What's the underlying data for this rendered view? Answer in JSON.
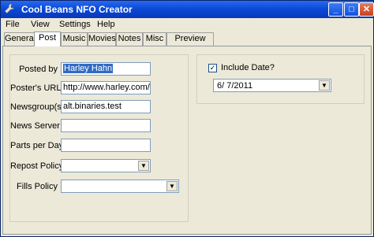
{
  "window": {
    "title": "Cool Beans NFO Creator",
    "controls": {
      "minimize": "_",
      "maximize": "□",
      "close": "✕"
    }
  },
  "menu": [
    "File",
    "View",
    "Settings",
    "Help"
  ],
  "tabs": [
    "General",
    "Post",
    "Music",
    "Movies",
    "Notes",
    "Misc",
    "Preview .nfo"
  ],
  "active_tab": "Post",
  "post": {
    "posted_by_label": "Posted by",
    "posted_by_value": "Harley Hahn",
    "url_label": "Poster's URL",
    "url_value": "http://www.harley.com/",
    "newsgroup_label": "Newsgroup(s)",
    "newsgroup_value": "alt.binaries.test",
    "server_label": "News Server",
    "server_value": "",
    "parts_label": "Parts per Day",
    "parts_value": "",
    "repost_label": "Repost Policy",
    "repost_value": "",
    "fills_label": "Fills Policy",
    "fills_value": ""
  },
  "date": {
    "include_label": "Include Date?",
    "include_checked": true,
    "check_mark": "✓",
    "value": "6/ 7/2011"
  },
  "icons": {
    "app": "wrench-icon",
    "dropdown": "▼"
  }
}
